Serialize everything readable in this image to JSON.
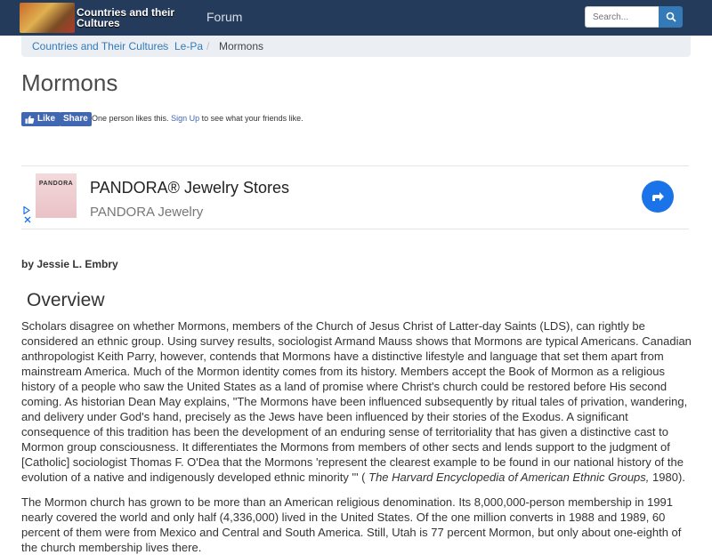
{
  "header": {
    "logo_text": "Countries and their Cultures",
    "nav_forum": "Forum",
    "search_placeholder": "Search..."
  },
  "breadcrumb": {
    "items": [
      "Countries and Their Cultures",
      "Le-Pa",
      "Mormons"
    ],
    "separator": "/"
  },
  "page": {
    "title": "Mormons"
  },
  "facebook": {
    "like_label": "Like",
    "share_label": "Share",
    "text_before": "One person likes this.",
    "signup_label": "Sign Up",
    "text_after": "to see what your friends like."
  },
  "ad": {
    "logo_text": "PANDORA",
    "title": "PANDORA® Jewelry Stores",
    "subtitle": "PANDORA Jewelry"
  },
  "article": {
    "byline": "by Jessie L. Embry",
    "section_heading": "Overview",
    "p1_part1": "Scholars disagree on whether Mormons, members of the Church of Jesus Christ of Latter-day Saints (LDS), can rightly be considered an ethnic group. Using survey results, sociologist Armand Mauss shows that Mormons are typical Americans. Canadian anthropologist Keith Parry, however, contends that Mormons have a distinctive lifestyle and language that set them apart from mainstream America. Much of the Mormon identity comes from its history. Members accept the Book of Mormon as a religious history of a people who saw the United States as a land of promise where Christ's church could be restored before His second coming. As historian Dean May explains, \"The Mormons have been influenced subsequently by ritual tales of privation, wandering, and delivery under God's hand, precisely as the Jews have been influenced by their stories of the Exodus. A significant consequence of this tradition has been the development of an enduring sense of territoriality that has given a distinctive cast to Mormon group consciousness. It differentiates the Mormons from members of other sects and lends support to the judgment of [Catholic] sociologist Thomas F. O'Dea that the Mormons 'represent the clearest example to be found in our national history of the evolution of a native and indigenously developed ethnic minority \"' ( ",
    "p1_italic": "The Harvard Encyclopedia of American Ethnic Groups,",
    "p1_part2": " 1980).",
    "p2": "The Mormon church has grown to be more than an American religious denomination. Its 8,000,000-person membership in 1991 nearly covered the world and only half (4,336,000) lived in the United States. Of the one million converts in 1988 and 1989, 60 percent of them were from Mexico and Central and South America. Still, Utah is 77 percent Mormon, but only about one-eighth of the church membership lives there."
  },
  "colors": {
    "navbar": "#243b5c",
    "link": "#337ab7",
    "breadcrumb_bg": "#ebeff4",
    "facebook": "#4267b2",
    "ad_arrow": "#1a73e8"
  }
}
